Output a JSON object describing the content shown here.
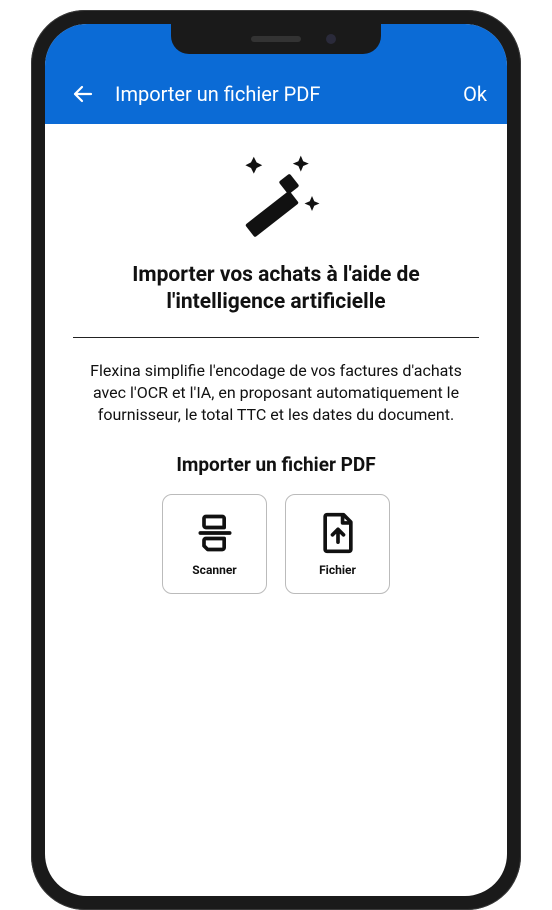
{
  "appBar": {
    "title": "Importer un fichier PDF",
    "okLabel": "Ok"
  },
  "content": {
    "headline": "Importer vos achats à l'aide de l'intelligence artificielle",
    "body": "Flexina simplifie l'encodage de vos factures d'achats avec l'OCR et l'IA, en proposant automatiquement le fournisseur, le total TTC et les dates du document.",
    "subHeadline": "Importer un fichier PDF",
    "actions": {
      "scanner": "Scanner",
      "file": "Fichier"
    }
  },
  "icons": {
    "back": "back-arrow-icon",
    "magic": "magic-wand-icon",
    "scanner": "scanner-icon",
    "file": "file-upload-icon"
  },
  "colors": {
    "primary": "#0b6bd6",
    "text": "#111111",
    "border": "#bbbbbb"
  }
}
